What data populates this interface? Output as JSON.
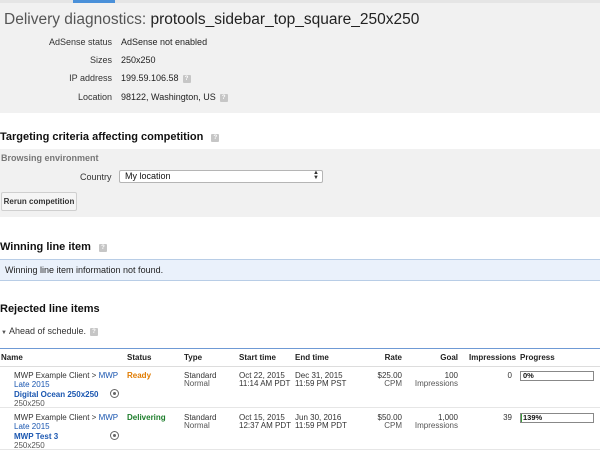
{
  "header": {
    "title_prefix": "Delivery diagnostics:",
    "title_name": "protools_sidebar_top_square_250x250"
  },
  "info": [
    {
      "label": "AdSense status",
      "value": "AdSense not enabled",
      "help": false
    },
    {
      "label": "Sizes",
      "value": "250x250",
      "help": false
    },
    {
      "label": "IP address",
      "value": "199.59.106.58",
      "help": true
    },
    {
      "label": "Location",
      "value": "98122, Washington, US",
      "help": true
    }
  ],
  "targeting": {
    "title": "Targeting criteria affecting competition",
    "browsing_label": "Browsing environment",
    "country_label": "Country",
    "country_value": "My location",
    "rerun_label": "Rerun competition"
  },
  "winning": {
    "title": "Winning line item",
    "message": "Winning line item information not found."
  },
  "rejected": {
    "title": "Rejected line items",
    "group_label": "Ahead of schedule.",
    "columns": {
      "name": "Name",
      "status": "Status",
      "type": "Type",
      "start": "Start time",
      "end": "End time",
      "rate": "Rate",
      "goal": "Goal",
      "impressions": "Impressions",
      "progress": "Progress"
    },
    "rows": [
      {
        "client": "MWP Example Client >",
        "campaign_1": "MWP",
        "campaign_2": "Late 2015",
        "line_item": "Digital Ocean 250x250",
        "size": "250x250",
        "status": "Ready",
        "type_1": "Standard",
        "type_2": "Normal",
        "start_1": "Oct 22, 2015",
        "start_2": "11:14 AM PDT",
        "end_1": "Dec 31, 2015",
        "end_2": "11:59 PM PST",
        "rate_1": "$25.00",
        "rate_2": "CPM",
        "goal_1": "100",
        "goal_2": "Impressions",
        "impressions": "0",
        "progress_label": "0%",
        "progress_fraction": 0
      },
      {
        "client": "MWP Example Client >",
        "campaign_1": "MWP",
        "campaign_2": "Late 2015",
        "line_item": "MWP Test 3",
        "size": "250x250",
        "status": "Delivering",
        "type_1": "Standard",
        "type_2": "Normal",
        "start_1": "Oct 15, 2015",
        "start_2": "12:37 AM PDT",
        "end_1": "Jun 30, 2016",
        "end_2": "11:59 PM PDT",
        "rate_1": "$50.00",
        "rate_2": "CPM",
        "goal_1": "1,000",
        "goal_2": "Impressions",
        "impressions": "39",
        "progress_label": "139%",
        "progress_fraction": 0.02
      }
    ]
  },
  "colors": {
    "accent": "#4a90d9",
    "ready": "#e07b00",
    "delivering": "#1c7d2a",
    "link": "#1a56b0",
    "progress_fill": "#3a9d3a"
  }
}
